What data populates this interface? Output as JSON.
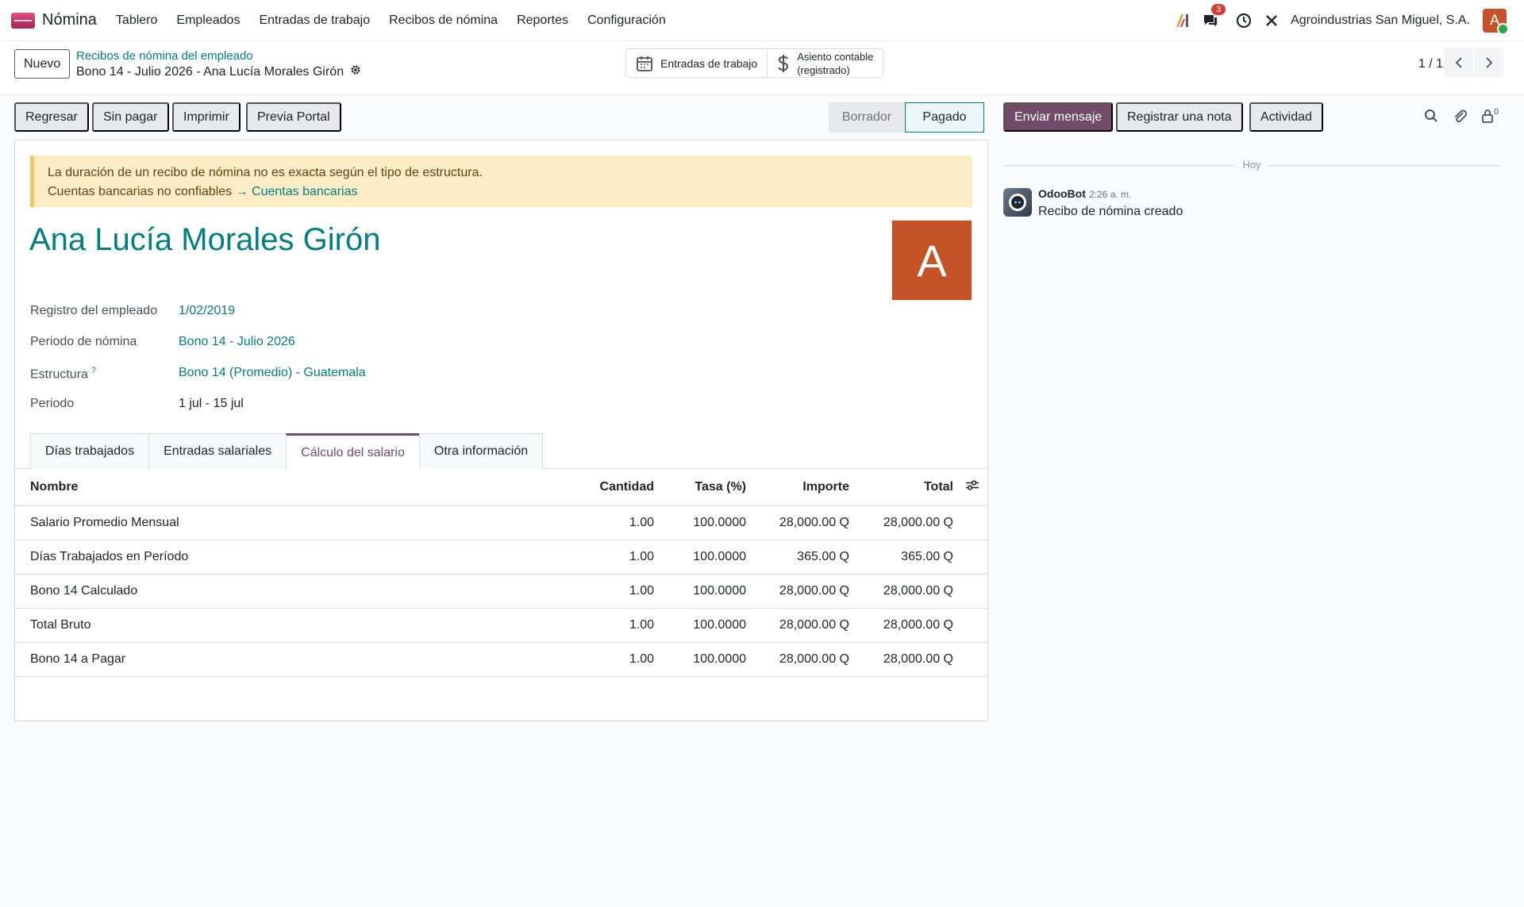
{
  "navbar": {
    "app_name": "Nómina",
    "menu": [
      "Tablero",
      "Empleados",
      "Entradas de trabajo",
      "Recibos de nómina",
      "Reportes",
      "Configuración"
    ],
    "messages_count": "3",
    "company": "Agroindustrias San Miguel, S.A.",
    "user_initial": "A"
  },
  "control": {
    "new_label": "Nuevo",
    "breadcrumb_parent": "Recibos de nómina del empleado",
    "breadcrumb_current": "Bono 14 - Julio 2026 - Ana Lucía Morales Girón",
    "smart_work_entries": "Entradas de trabajo",
    "smart_journal_line1": "Asiento contable",
    "smart_journal_line2": "(registrado)",
    "pager": "1 / 1"
  },
  "actions": {
    "back": "Regresar",
    "unpaid": "Sin pagar",
    "print": "Imprimir",
    "preview": "Previa Portal",
    "status_draft": "Borrador",
    "status_paid": "Pagado"
  },
  "chatter": {
    "send_message": "Enviar mensaje",
    "log_note": "Registrar una nota",
    "activity": "Actividad",
    "followers_count": "0",
    "date_separator": "Hoy",
    "message_author": "OdooBot",
    "message_time": "2:26 a. m.",
    "message_body": "Recibo de nómina creado"
  },
  "form": {
    "alert_line1": "La duración de un recibo de nómina no es exacta según el tipo de estructura.",
    "alert_line2": "Cuentas bancarias no confiables",
    "alert_link": "→ Cuentas bancarias",
    "employee_name": "Ana Lucía Morales Girón",
    "avatar_initial": "A",
    "fields": {
      "registro_label": "Registro del empleado",
      "registro_value": "1/02/2019",
      "periodo_nomina_label": "Periodo de nómina",
      "periodo_nomina_value": "Bono 14 - Julio 2026",
      "estructura_label": "Estructura",
      "estructura_help": "?",
      "estructura_value": "Bono 14 (Promedio) - Guatemala",
      "periodo_label": "Periodo",
      "periodo_value": "1 jul - 15 jul"
    },
    "tabs": [
      "Días trabajados",
      "Entradas salariales",
      "Cálculo del salario",
      "Otra información"
    ]
  },
  "table": {
    "headers": {
      "name": "Nombre",
      "qty": "Cantidad",
      "rate": "Tasa (%)",
      "amount": "Importe",
      "total": "Total"
    },
    "rows": [
      {
        "name": "Salario Promedio Mensual",
        "qty": "1.00",
        "rate": "100.0000",
        "amount": "28,000.00 Q",
        "total": "28,000.00 Q"
      },
      {
        "name": "Días Trabajados en Período",
        "qty": "1.00",
        "rate": "100.0000",
        "amount": "365.00 Q",
        "total": "365.00 Q"
      },
      {
        "name": "Bono 14 Calculado",
        "qty": "1.00",
        "rate": "100.0000",
        "amount": "28,000.00 Q",
        "total": "28,000.00 Q"
      },
      {
        "name": "Total Bruto",
        "qty": "1.00",
        "rate": "100.0000",
        "amount": "28,000.00 Q",
        "total": "28,000.00 Q"
      },
      {
        "name": "Bono 14 a Pagar",
        "qty": "1.00",
        "rate": "100.0000",
        "amount": "28,000.00 Q",
        "total": "28,000.00 Q"
      }
    ]
  }
}
